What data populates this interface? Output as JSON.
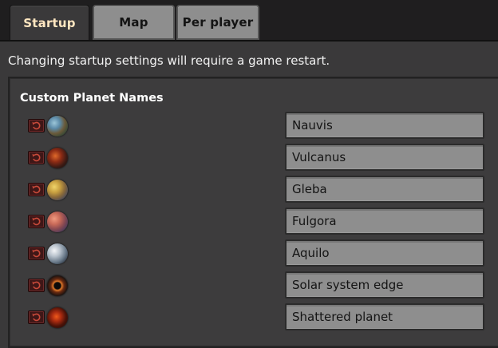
{
  "tabs": [
    {
      "label": "Startup",
      "active": true
    },
    {
      "label": "Map",
      "active": false
    },
    {
      "label": "Per player",
      "active": false
    }
  ],
  "notice": "Changing startup settings will require a game restart.",
  "section_title": "Custom Planet Names",
  "planets": [
    {
      "icon": "nauvis-planet-icon",
      "value": "Nauvis"
    },
    {
      "icon": "vulcanus-planet-icon",
      "value": "Vulcanus"
    },
    {
      "icon": "gleba-planet-icon",
      "value": "Gleba"
    },
    {
      "icon": "fulgora-planet-icon",
      "value": "Fulgora"
    },
    {
      "icon": "aquilo-planet-icon",
      "value": "Aquilo"
    },
    {
      "icon": "solar-system-edge-icon",
      "value": "Solar system edge"
    },
    {
      "icon": "shattered-planet-icon",
      "value": "Shattered planet"
    }
  ],
  "colors": {
    "active_tab_text": "#ffe6c0",
    "inactive_tab_bg": "#8e8e8e",
    "reset_button": "#3f1717",
    "input_bg": "#8e8e8e"
  }
}
